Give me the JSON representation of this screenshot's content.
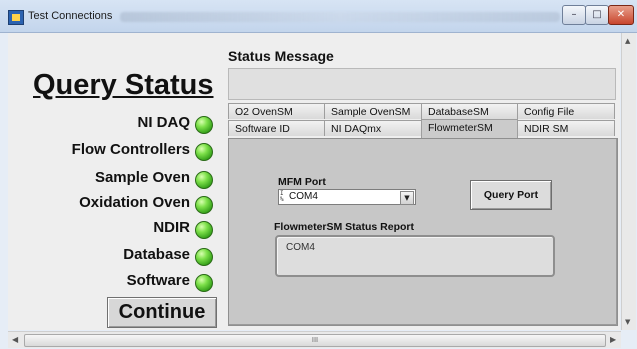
{
  "window": {
    "title": "Test Connections",
    "minimize": "–",
    "maximize": "□",
    "close": "✕"
  },
  "left_panel": {
    "heading": "Query Status",
    "items": [
      {
        "label": "NI DAQ",
        "status_color": "#4cc22a"
      },
      {
        "label": "Flow Controllers",
        "status_color": "#4cc22a"
      },
      {
        "label": "Sample  Oven",
        "status_color": "#4cc22a"
      },
      {
        "label": "Oxidation Oven",
        "status_color": "#4cc22a"
      },
      {
        "label": "NDIR",
        "status_color": "#4cc22a"
      },
      {
        "label": "Database",
        "status_color": "#4cc22a"
      },
      {
        "label": "Software",
        "status_color": "#4cc22a"
      }
    ],
    "continue_label": "Continue"
  },
  "status_message": {
    "label": "Status Message",
    "value": ""
  },
  "tabs": {
    "row1": [
      "O2 OvenSM",
      "Sample OvenSM",
      "DatabaseSM",
      "Config File"
    ],
    "row2": [
      "Software ID",
      "NI DAQmx",
      "FlowmeterSM",
      "NDIR SM"
    ],
    "active": "FlowmeterSM"
  },
  "flowmeter": {
    "port_label": "MFM Port",
    "port_value": "COM4",
    "query_button": "Query Port",
    "report_label": "FlowmeterSM Status Report",
    "report_value": "COM4"
  },
  "scrollbar": {
    "h_thumb_grip": "III"
  }
}
